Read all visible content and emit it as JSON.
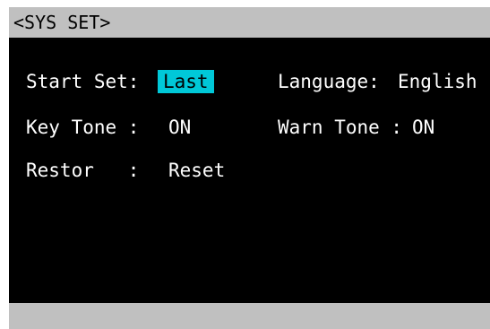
{
  "window": {
    "title": "<SYS SET>"
  },
  "settings": {
    "start_set": {
      "label": "Start Set:",
      "value": "Last",
      "selected": true
    },
    "language": {
      "label": "Language:",
      "value": "English"
    },
    "key_tone": {
      "label": "Key Tone :",
      "value": "ON"
    },
    "warn_tone": {
      "label": "Warn Tone :",
      "value": "ON"
    },
    "restor": {
      "label": "Restor   :",
      "value": "Reset"
    }
  },
  "colors": {
    "background": "#000000",
    "text": "#ffffff",
    "bar": "#c0c0c0",
    "highlight": "#00c8d8"
  }
}
